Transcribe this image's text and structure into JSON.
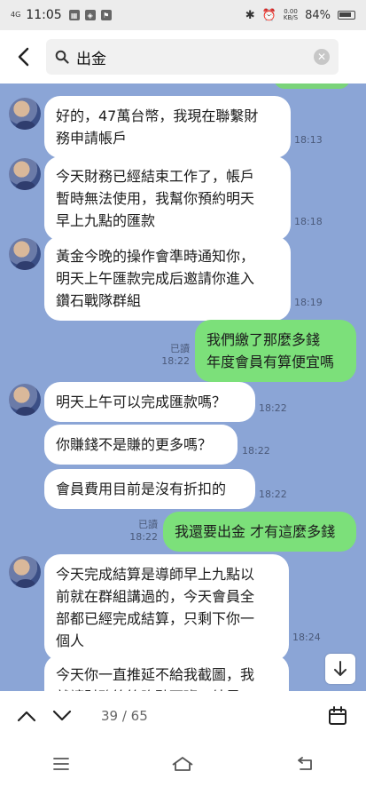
{
  "status_bar": {
    "time": "11:05",
    "network_label": "4G",
    "data_speed": "0.00\nKB/S",
    "battery": "84%"
  },
  "search": {
    "query": "出金"
  },
  "messages": [
    {
      "side": "in",
      "text": "好的，47萬台幣，我現在聯繫財\n務申請帳戶",
      "time": "18:13"
    },
    {
      "side": "in",
      "text": "今天財務已經結束工作了，帳戶\n暫時無法使用，我幫你預約明天\n早上九點的匯款",
      "time": "18:18"
    },
    {
      "side": "in",
      "text": "黃金今晚的操作會準時通知你，\n明天上午匯款完成后邀請你進入\n鑽石戰隊群組",
      "time": "18:19"
    },
    {
      "side": "out",
      "text": "我們繳了那麼多錢\n年度會員有算便宜嗎",
      "read": "已讀",
      "time": "18:22"
    },
    {
      "side": "in",
      "text": "明天上午可以完成匯款嗎？",
      "time": "18:22"
    },
    {
      "side": "in",
      "text": "你賺錢不是賺的更多嗎？",
      "time": "18:22"
    },
    {
      "side": "in",
      "text": "會員費用目前是沒有折扣的",
      "time": "18:22"
    },
    {
      "side": "out",
      "text": "我還要出金 才有這麼多錢",
      "read": "已讀",
      "time": "18:22"
    },
    {
      "side": "in",
      "text": "今天完成結算是導師早上九點以\n前就在群組講過的，今天會員全\n部都已經完成結算，只剩下你一\n個人",
      "time": "18:24"
    },
    {
      "side": "in",
      "text": "今天你一直推延不給我截圖，我\n就讓財務等等晚點下班，結果一",
      "time": ""
    }
  ],
  "result_nav": {
    "current": "39",
    "total": "65",
    "counter_text": "39 / 65"
  },
  "colors": {
    "chat_bg": "#8ba5d6",
    "outgoing": "#7ce07a",
    "incoming": "#ffffff"
  }
}
